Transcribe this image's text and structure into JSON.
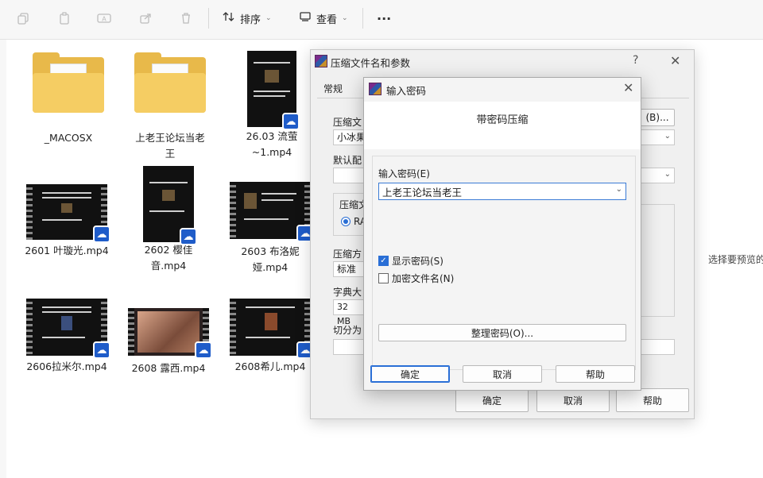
{
  "toolbar": {
    "icons": [
      "copy-icon",
      "paste-icon",
      "rename-icon",
      "share-icon",
      "delete-icon"
    ],
    "sort_label": "排序",
    "view_label": "查看",
    "more": "···"
  },
  "files": [
    {
      "name": "_MACOSX",
      "kind": "folder"
    },
    {
      "name": "上老王论坛当老王",
      "kind": "folder"
    },
    {
      "name": "26.03 流萤~1.mp4",
      "kind": "video"
    },
    {
      "name": "2601 叶璇光.mp4",
      "kind": "video"
    },
    {
      "name": "2602 樱佳音.mp4",
      "kind": "video"
    },
    {
      "name": "2603 布洛妮娅.mp4",
      "kind": "video"
    },
    {
      "name": "2606拉米尔.mp4",
      "kind": "video"
    },
    {
      "name": "2608 露西.mp4",
      "kind": "video"
    },
    {
      "name": "2608希儿.mp4",
      "kind": "video"
    }
  ],
  "side_text": "选择要预览的",
  "back_dialog": {
    "title": "压缩文件名和参数",
    "help": "?",
    "close": "✕",
    "tab_general": "常规",
    "lbl_archive_name": "压缩文",
    "archive_name_value": "小冰果",
    "lbl_default": "默认配",
    "lbl_format": "压缩文",
    "radio_rar": "RA",
    "lbl_method": "压缩方",
    "method_value": "标准",
    "lbl_dict": "字典大",
    "dict_value": "32 MB",
    "lbl_split": "切分为",
    "browse_button": "(B)...",
    "ok": "确定",
    "cancel": "取消",
    "help_btn": "帮助"
  },
  "password_dialog": {
    "title": "输入密码",
    "close": "✕",
    "header": "带密码压缩",
    "label_password": "输入密码(E)",
    "password_value": "上老王论坛当老王",
    "show_password": "显示密码(S)",
    "show_password_checked": true,
    "encrypt_names": "加密文件名(N)",
    "encrypt_names_checked": false,
    "organize_button": "整理密码(O)...",
    "ok": "确定",
    "cancel": "取消",
    "help": "帮助"
  }
}
